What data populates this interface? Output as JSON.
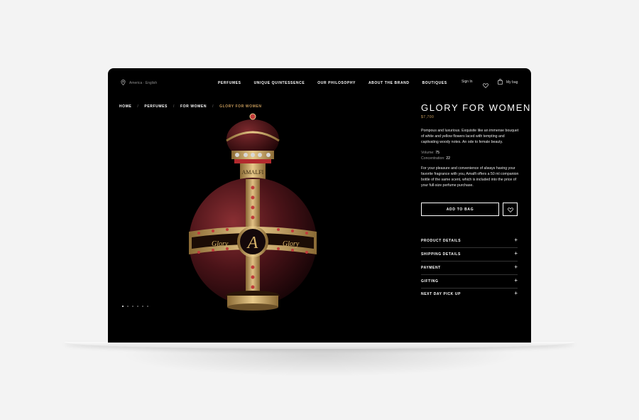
{
  "header": {
    "locale": "America · English",
    "nav": [
      "PERFUMES",
      "UNIQUE QUINTESSENCE",
      "OUR PHILOSOPHY",
      "ABOUT THE BRAND",
      "BOUTIQUES"
    ],
    "sign_in": "Sign In",
    "bag": "My bag"
  },
  "breadcrumb": {
    "items": [
      "HOME",
      "PERFUMES",
      "FOR WOMEN",
      "GLORY FOR WOMEN"
    ],
    "separator": "/"
  },
  "product": {
    "title": "GLORY FOR WOMEN",
    "price": "$7,700",
    "description": "Pompous and luxurious. Exquisite like an immense bouquet of white and yellow flowers laced with tempting and captivating woody notes. An ode to female beauty.",
    "volume_label": "Volume:",
    "volume_value": "75",
    "concentration_label": "Concentration:",
    "concentration_value": "22",
    "description2": "For your pleasure and convenience of always having your favorite fragrance with you, Amalfi offers a 50 ml companion bottle of the same scent, which is included into the price of your full-size perfume purchase.",
    "add_to_bag": "ADD TO BAG",
    "bottle_engraving": "Glory"
  },
  "accordion": [
    {
      "label": "PRODUCT DETAILS"
    },
    {
      "label": "SHIPPING DETAILS"
    },
    {
      "label": "PAYMENT"
    },
    {
      "label": "GIFTING"
    },
    {
      "label": "NEXT DAY PICK UP"
    }
  ],
  "gallery": {
    "slides": 6,
    "active": 1
  },
  "colors": {
    "accent": "#c79b5a",
    "background": "#000000",
    "page": "#f3f3f3"
  },
  "icons": [
    "location-pin-icon",
    "heart-icon",
    "bag-icon",
    "plus-icon"
  ]
}
